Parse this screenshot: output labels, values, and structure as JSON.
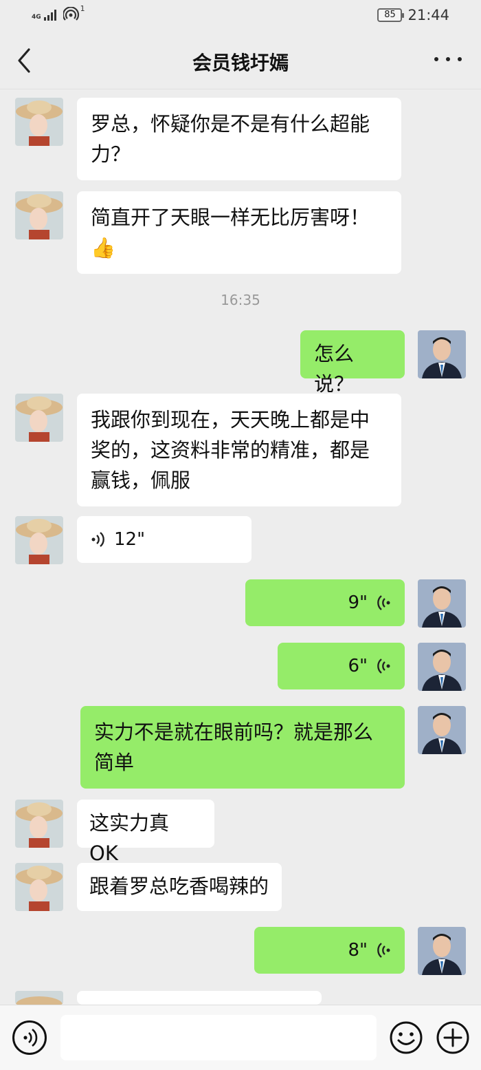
{
  "status": {
    "network": "4G",
    "hotspot_count": "1",
    "battery": "85",
    "time": "21:44"
  },
  "header": {
    "title": "会员钱圩嫣"
  },
  "timestamps": {
    "t1": "16:35"
  },
  "messages": [
    {
      "side": "left",
      "kind": "text",
      "text": "罗总，怀疑你是不是有什么超能力？"
    },
    {
      "side": "left",
      "kind": "text",
      "text": "简直开了天眼一样无比厉害呀！",
      "emoji": "👍"
    },
    {
      "side": "right",
      "kind": "text",
      "text": "怎么说？"
    },
    {
      "side": "left",
      "kind": "text",
      "text": "我跟你到现在，天天晚上都是中奖的，这资料非常的精准，都是赢钱，佩服"
    },
    {
      "side": "left",
      "kind": "voice",
      "text": "12\""
    },
    {
      "side": "right",
      "kind": "voice",
      "text": "9\""
    },
    {
      "side": "right",
      "kind": "voice",
      "text": "6\""
    },
    {
      "side": "right",
      "kind": "text",
      "text": "实力不是就在眼前吗？就是那么简单"
    },
    {
      "side": "left",
      "kind": "text",
      "text": "这实力真 OK"
    },
    {
      "side": "left",
      "kind": "text",
      "text": "跟着罗总吃香喝辣的"
    },
    {
      "side": "right",
      "kind": "voice",
      "text": "8\""
    }
  ],
  "icons": {
    "back": "chevron-left-icon",
    "more": "more-dots-icon",
    "voice_input": "voice-input-icon",
    "emoji": "emoji-icon",
    "plus": "plus-icon"
  },
  "colors": {
    "background": "#ededed",
    "bubble_sent": "#95ec69",
    "bubble_received": "#ffffff"
  }
}
